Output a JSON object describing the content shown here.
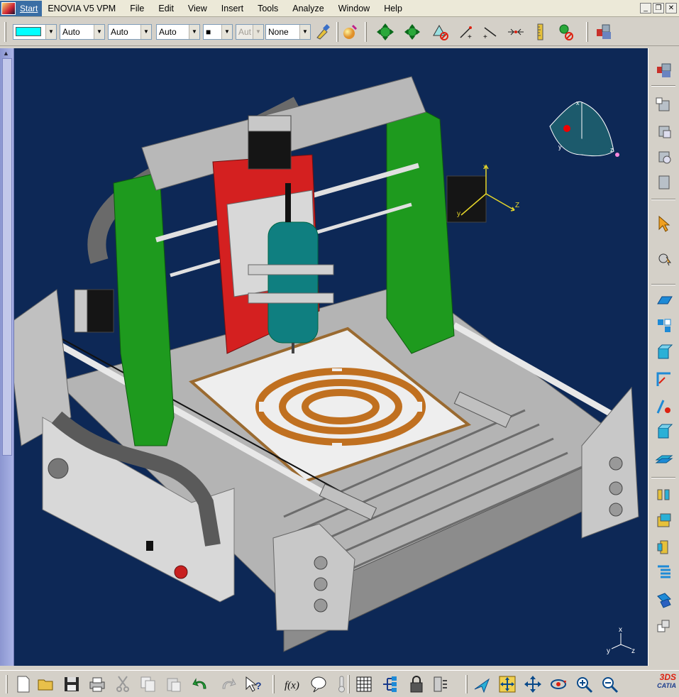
{
  "menubar": {
    "start": "Start",
    "enovia": "ENOVIA V5 VPM",
    "items": [
      {
        "label": "File",
        "key": "F"
      },
      {
        "label": "Edit",
        "key": "E"
      },
      {
        "label": "View",
        "key": "V"
      },
      {
        "label": "Insert",
        "key": "I"
      },
      {
        "label": "Tools",
        "key": "T"
      },
      {
        "label": "Analyze",
        "key": "A"
      },
      {
        "label": "Window",
        "key": "W"
      },
      {
        "label": "Help",
        "key": "H"
      }
    ]
  },
  "toolbar_top": {
    "color_swatch": "#00ffff",
    "dropdowns": [
      "Auto",
      "Auto",
      "Auto",
      "■",
      "Aut",
      "None"
    ],
    "icons": [
      "painter-brush-icon",
      "shading-sphere-icon",
      "fit-all-icon",
      "pan-icon",
      "hide-show-icon",
      "axis-icon",
      "line-icon",
      "constraint-icon",
      "measure-icon",
      "measure-item-icon",
      "properties-icon",
      "product-icon"
    ]
  },
  "compass": {
    "x": "x",
    "y": "y",
    "z": "z"
  },
  "axis_mid": {
    "x": "x",
    "y": "y",
    "z": "Z"
  },
  "axis_corner": {
    "x": "x",
    "y": "y",
    "z": "z"
  },
  "bottom": {
    "logo": "CATIA",
    "logo_mark": "3DS"
  },
  "colors": {
    "viewport": "#0d2856",
    "chrome": "#d4d0c8",
    "frame_green": "#1e9a1e",
    "carriage_red": "#d42020",
    "spindle_teal": "#0f7f80",
    "bed_grey": "#b4b4b4"
  }
}
